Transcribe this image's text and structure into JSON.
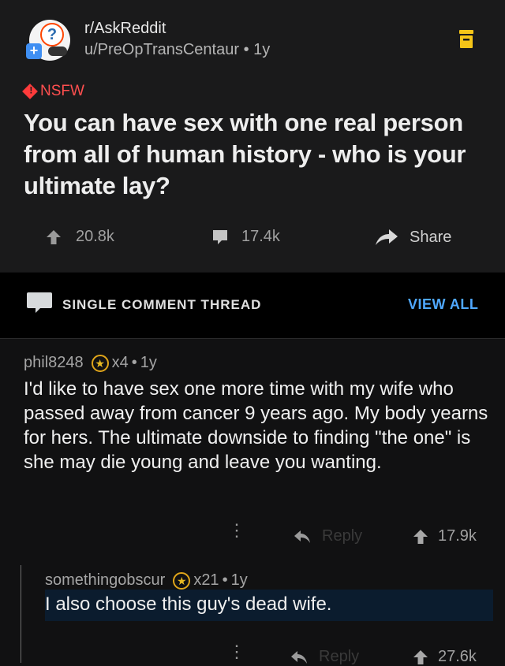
{
  "post": {
    "subreddit": "r/AskReddit",
    "author": "u/PreOpTransCentaur",
    "age": "1y",
    "nsfw_label": "NSFW",
    "title": "You can have sex with one real person from all of human history - who is your ultimate lay?",
    "upvotes": "20.8k",
    "comments": "17.4k",
    "share_label": "Share"
  },
  "thread_bar": {
    "label": "SINGLE COMMENT THREAD",
    "view_all": "VIEW ALL"
  },
  "comments": [
    {
      "author": "phil8248",
      "awards": "x4",
      "age": "1y",
      "body": "I'd like to have sex one more time with my wife who passed away from cancer 9 years ago. My body yearns for hers. The ultimate downside to finding \"the one\" is she may die young and leave you wanting.",
      "reply_label": "Reply",
      "score": "17.9k"
    },
    {
      "author": "somethingobscur",
      "awards": "x21",
      "age": "1y",
      "body": "I also choose this guy's dead wife.",
      "reply_label": "Reply",
      "score": "27.6k"
    }
  ],
  "colors": {
    "post_bg": "#1a1a1b",
    "page_bg": "#111112",
    "nsfw": "#ff4f4f",
    "link_blue": "#4fa8ff",
    "award_gold": "#e8b923",
    "highlight": "#0b1c2e"
  }
}
